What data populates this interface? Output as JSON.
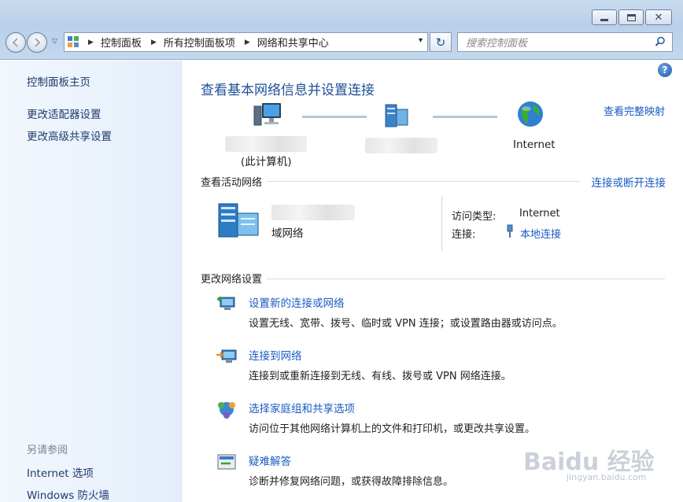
{
  "window": {
    "min_symbol": "",
    "close_symbol": "✕"
  },
  "address": {
    "crumbs": [
      "控制面板",
      "所有控制面板项",
      "网络和共享中心"
    ],
    "separator": "▶",
    "dropdown": "▾",
    "refresh_symbol": "↻"
  },
  "search": {
    "placeholder": "搜索控制面板"
  },
  "sidebar": {
    "items": [
      {
        "label": "控制面板主页"
      },
      {
        "label": "更改适配器设置"
      },
      {
        "label": "更改高级共享设置"
      }
    ],
    "see_also_heading": "另请参阅",
    "see_also": [
      {
        "label": "Internet 选项"
      },
      {
        "label": "Windows 防火墙"
      }
    ]
  },
  "main": {
    "help_symbol": "?",
    "title": "查看基本网络信息并设置连接",
    "view_full_map": "查看完整映射",
    "map": {
      "this_computer": "(此计算机)",
      "internet": "Internet"
    },
    "active_networks": {
      "heading": "查看活动网络",
      "connect_disconnect": "连接或断开连接",
      "network_type": "域网络",
      "access_type_label": "访问类型:",
      "access_type_value": "Internet",
      "connections_label": "连接:",
      "connection_link": "本地连接"
    },
    "change_settings": {
      "heading": "更改网络设置",
      "tasks": [
        {
          "title": "设置新的连接或网络",
          "desc": "设置无线、宽带、拨号、临时或 VPN 连接；或设置路由器或访问点。",
          "icon": "new-connection-icon"
        },
        {
          "title": "连接到网络",
          "desc": "连接到或重新连接到无线、有线、拨号或 VPN 网络连接。",
          "icon": "connect-network-icon"
        },
        {
          "title": "选择家庭组和共享选项",
          "desc": "访问位于其他网络计算机上的文件和打印机，或更改共享设置。",
          "icon": "homegroup-icon"
        },
        {
          "title": "疑难解答",
          "desc": "诊断并修复网络问题，或获得故障排除信息。",
          "icon": "troubleshoot-icon"
        }
      ]
    }
  },
  "watermark": {
    "text": "Baidu 经验",
    "url": "jingyan.baidu.com"
  }
}
